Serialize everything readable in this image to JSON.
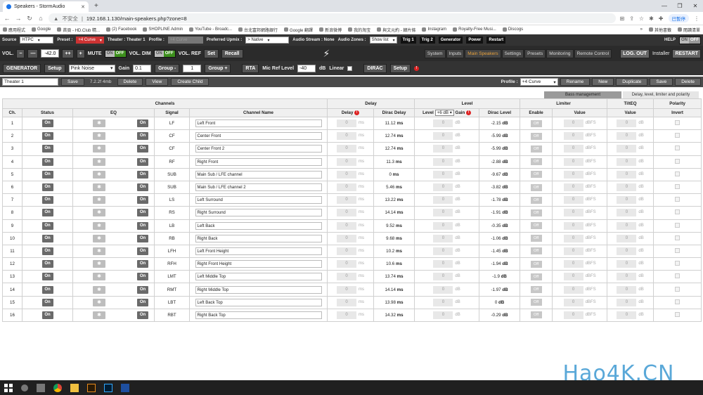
{
  "browser": {
    "tab_title": "Speakers - StormAudio",
    "security_label": "不安全",
    "url": "192.168.1.130/main-speakers.php?zone=8",
    "profile_label": "已暫停",
    "bookmarks": [
      "應用程式",
      "Google",
      "首頁 - HD.Club 精...",
      "(2) Facebook",
      "SHOPLINE Admin",
      "YouTube - Broadc...",
      "台北富邦網路銀行",
      "Google 翻譯",
      "新浪微博",
      "我的淘宝",
      "與文元約 - 韓片條",
      "Instagram",
      "Royalty-Free Musi...",
      "Discogs"
    ],
    "bookmarks_more": "»",
    "reading_list": "閱讀清單",
    "other_bookmarks": "其他書籤"
  },
  "toolbar1": {
    "source_label": "Source",
    "source_value": "HTPC",
    "preset_label": "Preset :",
    "preset_value": "+4 Curve",
    "theater_label": "Theater : Theater 1",
    "profile_label": "Profile :",
    "profile_value": "+4 Curve",
    "upmix_label": "Preferred Upmix :",
    "upmix_value": "> Native",
    "audio_stream": "Audio Stream : None",
    "audio_zones_label": "Audio Zones :",
    "audio_zones_value": "Show list",
    "trig1": "Trig 1",
    "trig2": "Trig 2",
    "generator": "Generator",
    "power": "Power",
    "restart": "Restart",
    "help": "HELP",
    "help_on": "ON",
    "help_off": "OFF"
  },
  "toolbar2": {
    "vol_label": "VOL.",
    "minus": "−",
    "minus2": "—",
    "vol_value": "-42.0",
    "plusplus": "++",
    "plus": "+",
    "mute": "MUTE",
    "mute_on": "ON",
    "mute_off": "OFF",
    "vol_dim": "VOL. DIM",
    "dim_on": "ON",
    "dim_off": "OFF",
    "vol_ref": "VOL. REF",
    "set": "Set",
    "recall": "Recall",
    "nav": [
      "System",
      "Inputs",
      "Main Speakers",
      "Settings",
      "Presets",
      "Monitoring",
      "Remote Control"
    ],
    "active_nav": "Main Speakers",
    "logout": "LOG. OUT",
    "installer": "Installer",
    "restart": "RESTART"
  },
  "toolbar3": {
    "generator": "GENERATOR",
    "setup": "Setup",
    "noise": "Pink Noise",
    "gain_label": "Gain",
    "gain_value": "0.1",
    "group_minus": "Group -",
    "group_value": "1",
    "group_plus": "Group +",
    "rta": "RTA",
    "mic_ref_label": "Mic Ref Level",
    "mic_ref_value": "-40",
    "db": "dB",
    "linear": "Linear",
    "dirac": "DIRAC",
    "dirac_setup": "Setup",
    "dirac_icon": "!"
  },
  "toolbar4": {
    "theater_value": "Theater 1",
    "save": "Save",
    "size": "7.2.2f 4mb",
    "delete": "Delete",
    "view": "View",
    "create_child": "Create Child",
    "profile_label": "Profile :",
    "profile_value": "+4 Curve",
    "rename": "Rename",
    "new": "New",
    "duplicate": "Duplicate",
    "save2": "Save",
    "delete2": "Delete"
  },
  "subtabs": {
    "bass": "Bass management",
    "delay": "Delay, level, limiter and polarity"
  },
  "table": {
    "group_headers": {
      "channels": "Channels",
      "delay": "Delay",
      "level": "Level",
      "limiter": "Limiter",
      "tilteq": "TiltEQ",
      "polarity": "Polarity"
    },
    "headers": {
      "ch": "Ch.",
      "status": "Status",
      "eq": "EQ",
      "signal": "Signal",
      "name": "Channel Name",
      "delay": "Delay",
      "dirac_delay": "Dirac Delay",
      "level": "Level",
      "level_sel": "+6 dB",
      "gain": "Gain",
      "dirac_level": "Dirac Level",
      "enable": "Enable",
      "value": "Value",
      "tvalue": "Value",
      "invert": "Invert"
    },
    "on_label": "On",
    "off_label": "Off",
    "zero": "0",
    "units": {
      "ms": "ms",
      "db": "dB",
      "dbfs": "dBFS"
    },
    "rows": [
      {
        "ch": "1",
        "signal": "LF",
        "name": "Left Front",
        "dirac_delay": "11.12",
        "dirac_level": "-2.15"
      },
      {
        "ch": "2",
        "signal": "CF",
        "name": "Center Front",
        "dirac_delay": "12.74",
        "dirac_level": "-5.99"
      },
      {
        "ch": "3",
        "signal": "CF",
        "name": "Center Front 2",
        "dirac_delay": "12.74",
        "dirac_level": "-5.99"
      },
      {
        "ch": "4",
        "signal": "RF",
        "name": "Right Front",
        "dirac_delay": "11.3",
        "dirac_level": "-2.88"
      },
      {
        "ch": "5",
        "signal": "SUB",
        "name": "Main Sub / LFE channel",
        "dirac_delay": "0",
        "dirac_level": "-9.67"
      },
      {
        "ch": "6",
        "signal": "SUB",
        "name": "Main Sub / LFE channel 2",
        "dirac_delay": "5.46",
        "dirac_level": "-3.82"
      },
      {
        "ch": "7",
        "signal": "LS",
        "name": "Left Surround",
        "dirac_delay": "13.22",
        "dirac_level": "-1.78"
      },
      {
        "ch": "8",
        "signal": "RS",
        "name": "Right Surround",
        "dirac_delay": "14.14",
        "dirac_level": "-1.91"
      },
      {
        "ch": "9",
        "signal": "LB",
        "name": "Left Back",
        "dirac_delay": "9.52",
        "dirac_level": "-0.35"
      },
      {
        "ch": "10",
        "signal": "RB",
        "name": "Right Back",
        "dirac_delay": "9.68",
        "dirac_level": "-1.06"
      },
      {
        "ch": "11",
        "signal": "LFH",
        "name": "Left Front Height",
        "dirac_delay": "10.2",
        "dirac_level": "-1.45"
      },
      {
        "ch": "12",
        "signal": "RFH",
        "name": "Right Front Height",
        "dirac_delay": "10.6",
        "dirac_level": "-1.94"
      },
      {
        "ch": "13",
        "signal": "LMT",
        "name": "Left Middle Top",
        "dirac_delay": "13.74",
        "dirac_level": "-1.9"
      },
      {
        "ch": "14",
        "signal": "RMT",
        "name": "Right Middle Top",
        "dirac_delay": "14.14",
        "dirac_level": "-1.97"
      },
      {
        "ch": "15",
        "signal": "LBT",
        "name": "Left Back Top",
        "dirac_delay": "13.98",
        "dirac_level": "0"
      },
      {
        "ch": "16",
        "signal": "RBT",
        "name": "Right Back Top",
        "dirac_delay": "14.32",
        "dirac_level": "-0.29"
      }
    ]
  },
  "watermark": "Hao4K.CN",
  "colors": {
    "accent": "#e9a23b",
    "on_green": "#3c8f1c",
    "preset_red": "#cc3333"
  }
}
